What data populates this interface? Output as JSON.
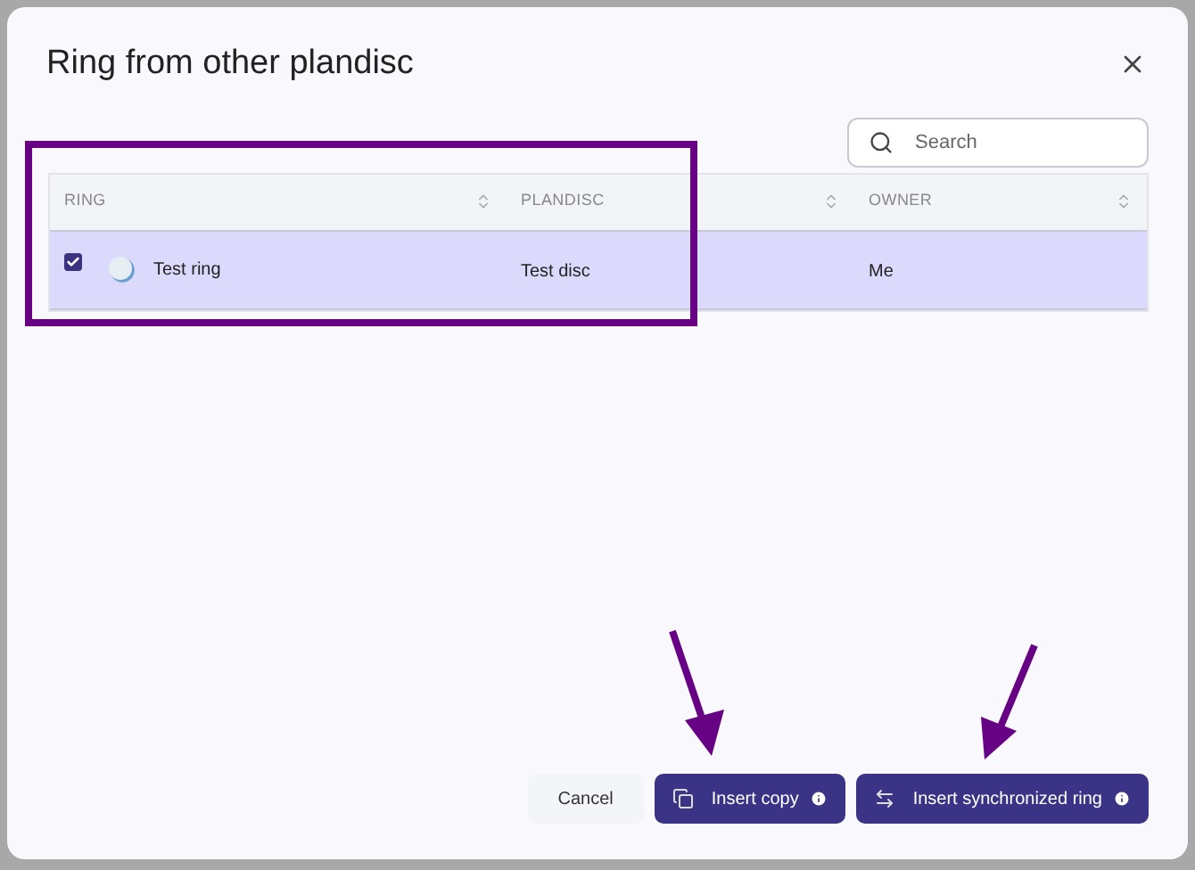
{
  "dialog": {
    "title": "Ring from other plandisc"
  },
  "search": {
    "placeholder": "Search"
  },
  "table": {
    "columns": [
      "RING",
      "PLANDISC",
      "OWNER"
    ],
    "rows": [
      {
        "selected": true,
        "ring": "Test ring",
        "plandisc": "Test disc",
        "owner": "Me"
      }
    ]
  },
  "buttons": [
    {
      "kind": "plain",
      "label": "Cancel"
    },
    {
      "kind": "copy",
      "label": "Insert copy"
    },
    {
      "kind": "sync",
      "label": "Insert synchronized ring"
    }
  ]
}
